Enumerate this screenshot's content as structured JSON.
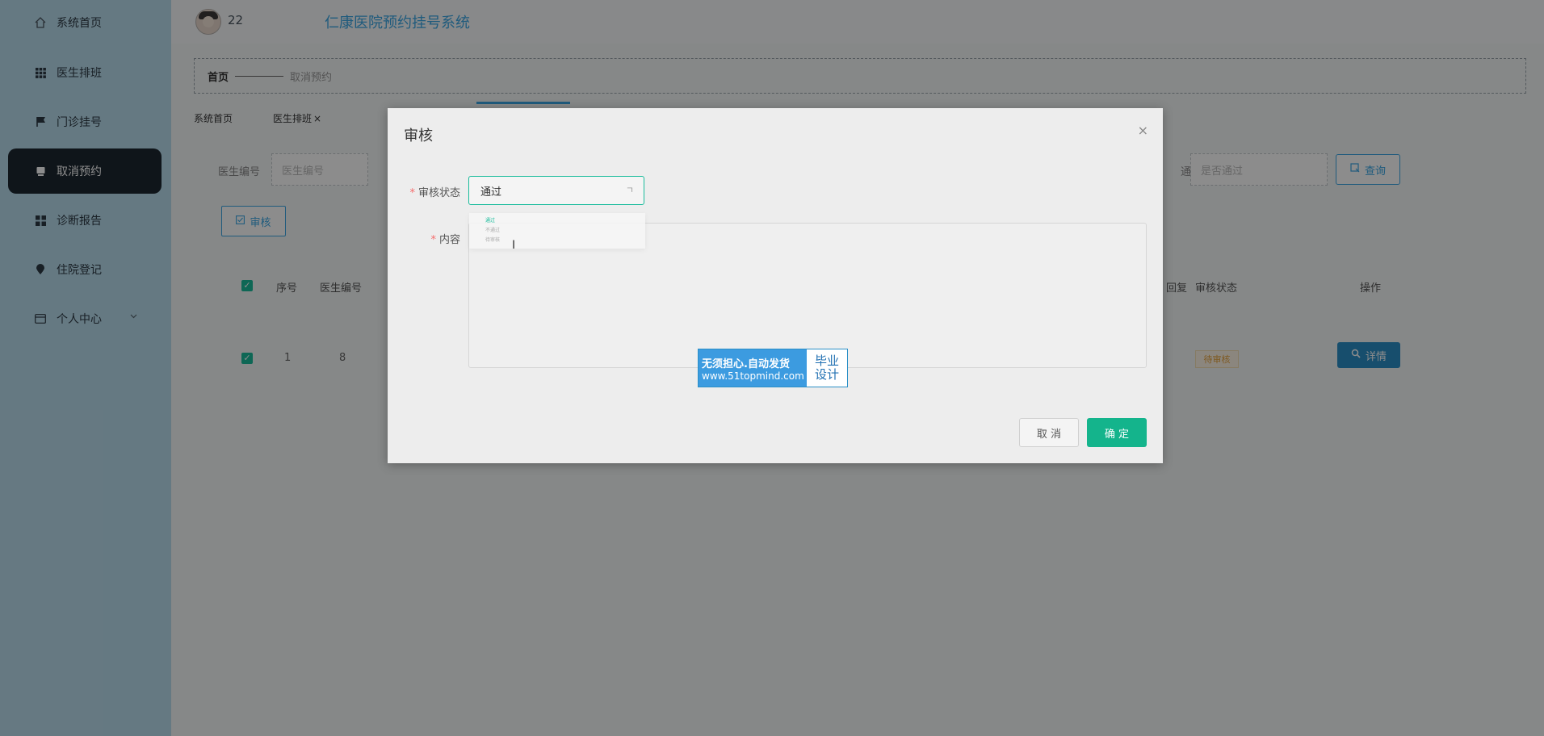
{
  "sidebar": {
    "items": [
      {
        "label": "系统首页",
        "icon": "home-icon"
      },
      {
        "label": "医生排班",
        "icon": "grid-icon"
      },
      {
        "label": "门诊挂号",
        "icon": "flag-icon"
      },
      {
        "label": "取消预约",
        "icon": "cancel-icon",
        "active": true
      },
      {
        "label": "诊断报告",
        "icon": "dashboard-icon"
      },
      {
        "label": "住院登记",
        "icon": "location-icon"
      },
      {
        "label": "个人中心",
        "icon": "card-icon"
      }
    ]
  },
  "header": {
    "username": "22",
    "title": "仁康医院预约挂号系统"
  },
  "breadcrumb": {
    "home": "首页",
    "current": "取消预约"
  },
  "tabs": [
    "系统首页",
    "医生排班"
  ],
  "tab_close": "×",
  "filters": {
    "doctor_no_label": "医生编号",
    "doctor_no_placeholder": "医生编号",
    "pass_label_partial": "通过",
    "pass_placeholder": "是否通过",
    "query_label": "查询"
  },
  "actions": {
    "audit_label": "审核"
  },
  "table": {
    "headers": {
      "index": "序号",
      "doctor_no": "医生编号",
      "reply_partial": "回复",
      "audit_status": "审核状态",
      "ops": "操作"
    },
    "row": {
      "index": "1",
      "doctor_no": "8",
      "status": "待审核",
      "detail": "详情"
    }
  },
  "dialog": {
    "title": "审核",
    "close": "×",
    "status_label": "审核状态",
    "status_value": "通过",
    "content_label": "内容",
    "dropdown_options": [
      "通过",
      "不通过",
      "待审核"
    ],
    "cancel": "取 消",
    "confirm": "确 定"
  },
  "watermark": {
    "line1": "无须担心.自动发货",
    "line2": "www.51topmind.com",
    "right1": "毕业",
    "right2": "设计"
  },
  "colors": {
    "primary": "#3ba7e4",
    "success": "#1abc9c",
    "sidebar_bg": "#b9dced",
    "active_bg": "#1d2730"
  }
}
